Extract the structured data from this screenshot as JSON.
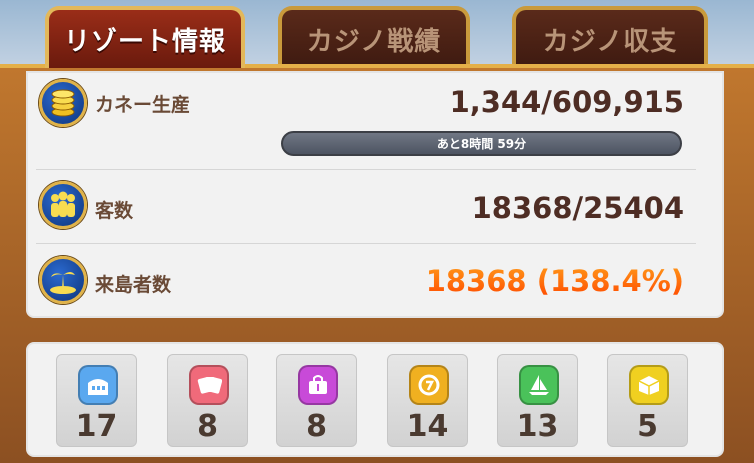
{
  "tabs": [
    {
      "label": "リゾート情報",
      "active": true
    },
    {
      "label": "カジノ戦績",
      "active": false
    },
    {
      "label": "カジノ収支",
      "active": false
    }
  ],
  "stats": {
    "money": {
      "label": "カネー生産",
      "value": "1,344/609,915",
      "icon": "coins-icon"
    },
    "timer": {
      "text": "あと8時間 59分"
    },
    "guests": {
      "label": "客数",
      "value": "18368/25404",
      "icon": "people-icon"
    },
    "visitors": {
      "label": "来島者数",
      "value": "18368 (138.4%)",
      "icon": "island-icon"
    }
  },
  "facilities": [
    {
      "icon": "building-icon",
      "color": "#5aa8ef",
      "count": "17"
    },
    {
      "icon": "cards-icon",
      "color": "#f06a7a",
      "count": "8"
    },
    {
      "icon": "shop-icon",
      "color": "#c84ad8",
      "count": "8"
    },
    {
      "icon": "slot-icon",
      "color": "#f0b020",
      "count": "14"
    },
    {
      "icon": "sailboat-icon",
      "color": "#4ac25a",
      "count": "13"
    },
    {
      "icon": "box-icon",
      "color": "#f0d020",
      "count": "5"
    }
  ]
}
